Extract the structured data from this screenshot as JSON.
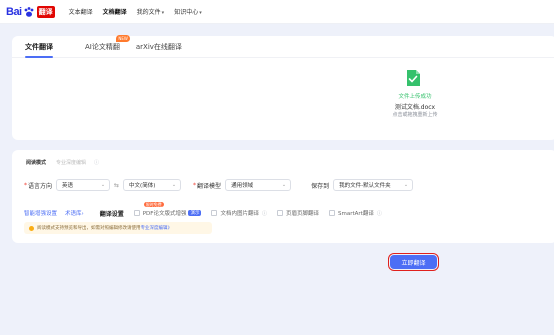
{
  "logo": {
    "bai": "Bai",
    "fanyi": "翻译"
  },
  "nav": {
    "items": [
      {
        "label": "文本翻译",
        "active": false,
        "caret": ""
      },
      {
        "label": "文档翻译",
        "active": true,
        "caret": ""
      },
      {
        "label": "我的文件",
        "active": false,
        "caret": "▾"
      },
      {
        "label": "知识中心",
        "active": false,
        "caret": "▾"
      }
    ]
  },
  "tabs": {
    "t1": "文件翻译",
    "t2": "AI论文精翻",
    "t2_badge": "NEW",
    "t3": "arXiv在线翻译"
  },
  "upload": {
    "status": "文件上传成功",
    "filename": "测试文档.docx",
    "reupload": "点击或拖拽重新上传",
    "icon": "file-check-icon",
    "color": "#35c16c"
  },
  "settings": {
    "tab_active": "阅读模式",
    "tab_disabled": "专业深度编辑",
    "direction_label": "语言方向",
    "source_lang": "英语",
    "swap": "⇆",
    "target_lang": "中文(简体)",
    "model_label": "翻译模型",
    "model_value": "通用领域",
    "save_label": "保存到",
    "save_value": "我的文件-默认文件夹",
    "term_link": "智能增强设置",
    "term_link2": "术语库›",
    "translate_settings": "翻译设置",
    "pdf_option": "PDF论文版式增强",
    "pdf_demo": "演示",
    "pdf_badge": "限时免费",
    "img_option": "文档内图片翻译",
    "footnote_option": "页眉页脚翻译",
    "smartart_option": "SmartArt翻译",
    "notice_text": "阅读模式支持预览和导出，如需对照编辑修改请使用",
    "notice_link": "专业深度编辑》"
  },
  "action": {
    "translate": "立即翻译"
  },
  "colors": {
    "accent": "#4c6ef5",
    "required": "#f04134",
    "highlight": "#e0201c"
  }
}
